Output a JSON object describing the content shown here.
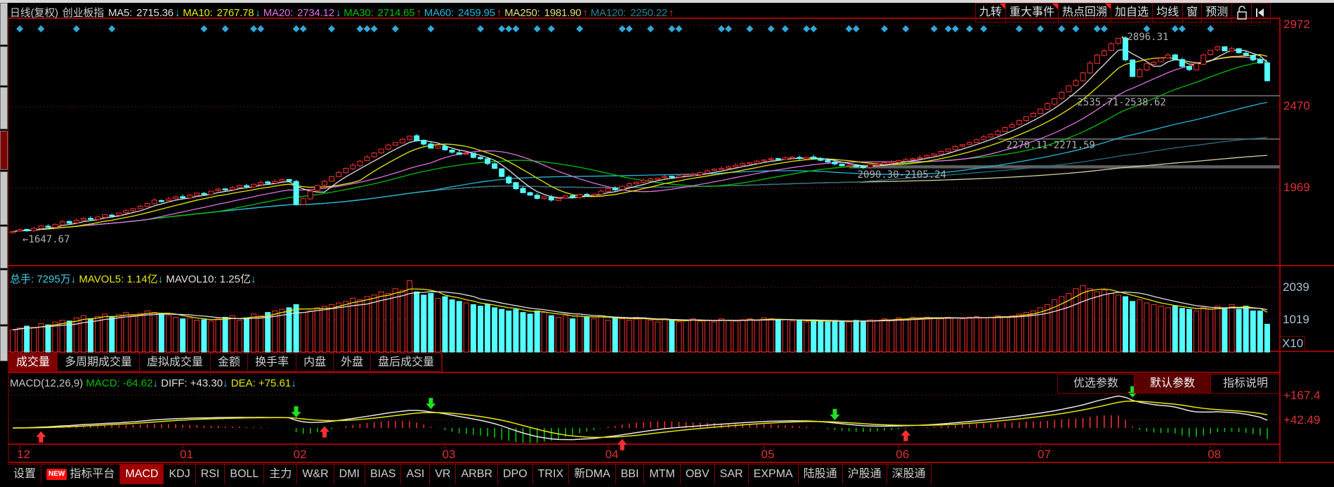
{
  "header": {
    "period": "日线(复权)",
    "index_name": "创业板指",
    "ma": [
      {
        "label": "MA5:",
        "value": "2715.36",
        "dir": "↓",
        "color": "#e0e0e0"
      },
      {
        "label": "MA10:",
        "value": "2767.78",
        "dir": "↓",
        "color": "#e8e800"
      },
      {
        "label": "MA20:",
        "value": "2734.12",
        "dir": "↓",
        "color": "#e070e0"
      },
      {
        "label": "MA30:",
        "value": "2714.65",
        "dir": "↑",
        "color": "#00c000"
      },
      {
        "label": "MA60:",
        "value": "2459.95",
        "dir": "↑",
        "color": "#20b8d8"
      },
      {
        "label": "MA250:",
        "value": "1981.90",
        "dir": "↑",
        "color": "#e8d880"
      },
      {
        "label": "MA120:",
        "value": "2250.22",
        "dir": "↑",
        "color": "#2a8090"
      }
    ]
  },
  "toolbar": [
    "九转",
    "重大事件",
    "热点回溯",
    "加自选",
    "均线",
    "窗",
    "预测"
  ],
  "price_axis": [
    "2972",
    "2470",
    "1969"
  ],
  "volume": {
    "total_label": "总手:",
    "total": "7295万",
    "total_dir": "↓",
    "mavol5_label": "MAVOL5:",
    "mavol5": "1.14亿",
    "mavol5_dir": "↓",
    "mavol10_label": "MAVOL10:",
    "mavol10": "1.25亿",
    "mavol10_dir": "↓",
    "axis": [
      "2039",
      "1019"
    ],
    "unit": "X10",
    "tabs": [
      "成交量",
      "多周期成交量",
      "虚拟成交量",
      "金额",
      "换手率",
      "内盘",
      "外盘",
      "盘后成交量"
    ]
  },
  "macd": {
    "name": "MACD(12,26,9)",
    "macd_label": "MACD:",
    "macd": "-64.62",
    "macd_dir": "↓",
    "diff_label": "DIFF:",
    "diff": "+43.30",
    "diff_dir": "↓",
    "dea_label": "DEA:",
    "dea": "+75.61",
    "dea_dir": "↓",
    "buttons": [
      "优选参数",
      "默认参数",
      "指标说明"
    ],
    "axis": [
      "+167.4",
      "+42.49"
    ]
  },
  "dates": [
    {
      "label": "12",
      "bar": 1
    },
    {
      "label": "01",
      "bar": 24
    },
    {
      "label": "02",
      "bar": 40
    },
    {
      "label": "03",
      "bar": 61
    },
    {
      "label": "04",
      "bar": 84
    },
    {
      "label": "05",
      "bar": 106
    },
    {
      "label": "06",
      "bar": 125
    },
    {
      "label": "07",
      "bar": 145
    },
    {
      "label": "08",
      "bar": 169
    }
  ],
  "bottom_tabs": [
    "设置",
    "指标平台",
    "MACD",
    "KDJ",
    "RSI",
    "BOLL",
    "主力",
    "W&R",
    "DMI",
    "BIAS",
    "ASI",
    "VR",
    "ARBR",
    "DPO",
    "TRIX",
    "新DMA",
    "BBI",
    "MTM",
    "OBV",
    "SAR",
    "EXPMA",
    "陆股通",
    "沪股通",
    "深股通"
  ],
  "new_badge": "NEW",
  "colors": {
    "up": "#ff3030",
    "down": "#54ffff",
    "grid": "#a00000"
  },
  "chart_data": {
    "type": "candlestick",
    "title": "创业板指 日线(复权)",
    "price_range": [
      1647.67,
      2972
    ],
    "annotations": [
      {
        "text": "←1647.67",
        "bar": 1,
        "price": 1647.67
      },
      {
        "text": "←2896.31",
        "bar": 156,
        "price": 2896.31
      }
    ],
    "gap_zones": [
      {
        "text": "2535.71-2538.62",
        "bar": 149,
        "low": 2535.71,
        "high": 2538.62
      },
      {
        "text": "2270.11-2271.59",
        "bar": 139,
        "low": 2270.11,
        "high": 2271.59
      },
      {
        "text": "2090.30-2105.24",
        "bar": 118,
        "low": 2090.3,
        "high": 2105.24
      }
    ],
    "signal_bars": [
      1,
      4,
      9,
      14,
      27,
      30,
      34,
      35,
      40,
      41,
      45,
      49,
      50,
      51,
      54,
      59,
      66,
      69,
      70,
      71,
      74,
      76,
      80,
      86,
      87,
      90,
      93,
      94,
      100,
      101,
      104,
      107,
      109,
      112,
      113,
      118,
      119,
      123,
      126,
      130,
      132,
      133,
      135,
      137,
      142,
      145,
      148,
      150,
      153,
      154,
      160,
      164,
      165,
      169
    ],
    "macd_buy_bars": [
      4,
      44,
      86,
      126
    ],
    "macd_sell_bars": [
      40,
      59,
      116,
      158
    ],
    "closes": [
      1700,
      1712,
      1705,
      1720,
      1735,
      1728,
      1745,
      1760,
      1752,
      1770,
      1782,
      1776,
      1790,
      1805,
      1798,
      1815,
      1830,
      1842,
      1856,
      1874,
      1895,
      1888,
      1902,
      1915,
      1908,
      1925,
      1938,
      1932,
      1950,
      1962,
      1958,
      1972,
      1985,
      1978,
      1992,
      2004,
      1998,
      2010,
      2022,
      2011,
      1869,
      1905,
      1950,
      1985,
      2010,
      2040,
      2065,
      2090,
      2110,
      2135,
      2160,
      2185,
      2210,
      2235,
      2250,
      2270,
      2289,
      2262,
      2240,
      2215,
      2228,
      2205,
      2190,
      2176,
      2182,
      2158,
      2150,
      2120,
      2090,
      2040,
      2000,
      1965,
      1940,
      1925,
      1905,
      1915,
      1895,
      1905,
      1920,
      1910,
      1930,
      1925,
      1932,
      1950,
      1965,
      1958,
      1980,
      1995,
      2005,
      2016,
      2025,
      2030,
      2040,
      2035,
      2045,
      2050,
      2053,
      2065,
      2075,
      2085,
      2090,
      2100,
      2110,
      2120,
      2125,
      2135,
      2142,
      2150,
      2145,
      2155,
      2160,
      2152,
      2158,
      2150,
      2140,
      2130,
      2118,
      2106,
      2110,
      2100,
      2095,
      2112,
      2116,
      2125,
      2130,
      2138,
      2145,
      2150,
      2158,
      2170,
      2180,
      2195,
      2210,
      2225,
      2237,
      2250,
      2268,
      2285,
      2300,
      2320,
      2342,
      2360,
      2385,
      2410,
      2430,
      2457,
      2490,
      2520,
      2560,
      2600,
      2631,
      2680,
      2740,
      2790,
      2815,
      2860,
      2893,
      2760,
      2657,
      2700,
      2736,
      2745,
      2770,
      2790,
      2762,
      2720,
      2700,
      2736,
      2790,
      2820,
      2840,
      2815,
      2830,
      2804,
      2790,
      2760,
      2740,
      2631
    ],
    "volumes": [
      700,
      760,
      820,
      780,
      900,
      860,
      950,
      1000,
      980,
      1080,
      1150,
      1050,
      1120,
      1200,
      1100,
      1180,
      1250,
      1150,
      1220,
      1300,
      1250,
      1200,
      1150,
      1100,
      1050,
      1080,
      1000,
      1020,
      980,
      1060,
      1100,
      1150,
      1000,
      1080,
      1200,
      1150,
      1250,
      1300,
      1350,
      1400,
      1500,
      1250,
      1300,
      1400,
      1450,
      1500,
      1550,
      1600,
      1700,
      1650,
      1750,
      1800,
      1900,
      1850,
      2000,
      1950,
      2250,
      1900,
      1800,
      1850,
      1700,
      1750,
      1650,
      1600,
      1550,
      1500,
      1450,
      1500,
      1400,
      1350,
      1300,
      1350,
      1250,
      1200,
      1300,
      1250,
      1150,
      1100,
      1150,
      1050,
      1200,
      1100,
      1050,
      1150,
      1000,
      1100,
      1050,
      1000,
      1100,
      1050,
      1000,
      950,
      1050,
      1000,
      950,
      1000,
      1050,
      980,
      1000,
      950,
      1050,
      1000,
      980,
      1020,
      1050,
      1000,
      1080,
      1050,
      1000,
      1020,
      980,
      1000,
      950,
      1000,
      980,
      950,
      1000,
      970,
      950,
      1000,
      980,
      1020,
      1000,
      1050,
      1020,
      1080,
      1050,
      1100,
      1080,
      1100,
      1080,
      1050,
      1100,
      1080,
      1050,
      1100,
      1120,
      1080,
      1100,
      1150,
      1120,
      1150,
      1200,
      1250,
      1300,
      1400,
      1500,
      1650,
      1750,
      1850,
      2000,
      2100,
      2000,
      1900,
      1950,
      1850,
      1800,
      1750,
      1600,
      1650,
      1550,
      1500,
      1450,
      1400,
      1450,
      1380,
      1350,
      1300,
      1400,
      1350,
      1450,
      1400,
      1500,
      1350,
      1450,
      1300,
      1300,
      880
    ],
    "ma_periods": [
      5,
      10,
      20,
      30,
      60,
      120,
      250
    ],
    "mavol_periods": [
      5,
      10
    ]
  }
}
